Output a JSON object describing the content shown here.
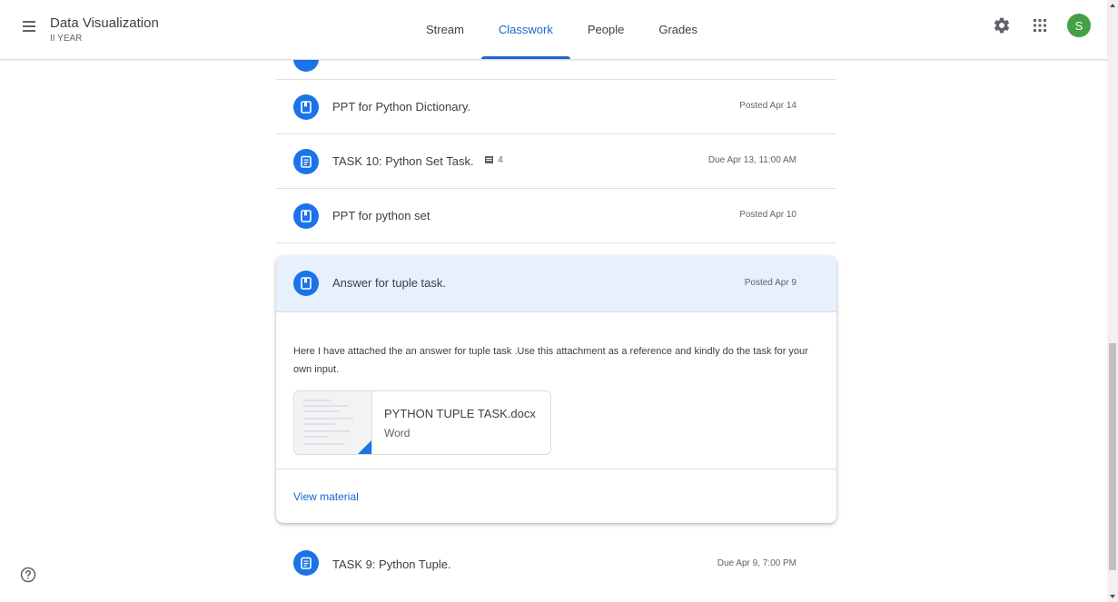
{
  "header": {
    "class_name": "Data Visualization",
    "class_section": "II YEAR",
    "tabs": [
      {
        "label": "Stream"
      },
      {
        "label": "Classwork"
      },
      {
        "label": "People"
      },
      {
        "label": "Grades"
      }
    ],
    "active_tab": "Classwork",
    "avatar_letter": "S",
    "avatar_color": "#43a047",
    "accent_color": "#1967d2"
  },
  "items": [
    {
      "title": "PPT for Python Dictionary.",
      "date": "Posted Apr 14",
      "icon": "material-icon"
    },
    {
      "title": "TASK 10: Python Set Task.",
      "date": "Due Apr 13, 11:00 AM",
      "icon": "assignment-icon",
      "comments": "4"
    },
    {
      "title": "PPT for python set",
      "date": "Posted Apr 10",
      "icon": "material-icon"
    }
  ],
  "expanded": {
    "title": "Answer for tuple task.",
    "date": "Posted Apr 9",
    "description": "Here I have attached the an answer for tuple task .Use this attachment as a reference and kindly do the task for your own input.",
    "attachment": {
      "name": "PYTHON TUPLE TASK.docx",
      "type": "Word"
    },
    "view_label": "View material"
  },
  "last_item": {
    "title": "TASK 9: Python Tuple.",
    "date": "Due Apr 9, 7:00 PM",
    "icon": "assignment-icon"
  }
}
